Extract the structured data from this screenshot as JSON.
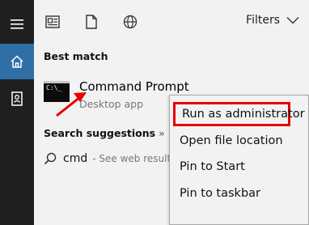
{
  "topbar": {
    "filters_label": "Filters",
    "icons": [
      "document-icon",
      "file-icon",
      "globe-icon",
      "chevron-down-icon"
    ]
  },
  "rail": {
    "items": [
      "hamburger-icon",
      "home-icon",
      "contact-icon"
    ],
    "active": "home-icon",
    "accent_color": "#2f6fa6"
  },
  "best_match": {
    "heading": "Best match",
    "title": "Command Prompt",
    "subtitle": "Desktop app",
    "icon_text": "C:\\_"
  },
  "suggestions": {
    "heading": "Search suggestions",
    "chevron": "»",
    "query": "cmd",
    "hint": "- See web results"
  },
  "context_menu": {
    "items": [
      {
        "label": "Run as administrator",
        "highlighted": true
      },
      {
        "label": "Open file location"
      },
      {
        "label": "Pin to Start"
      },
      {
        "label": "Pin to taskbar"
      }
    ],
    "highlight_color": "#e60000"
  },
  "annotation": {
    "arrow_color": "#e60000"
  }
}
